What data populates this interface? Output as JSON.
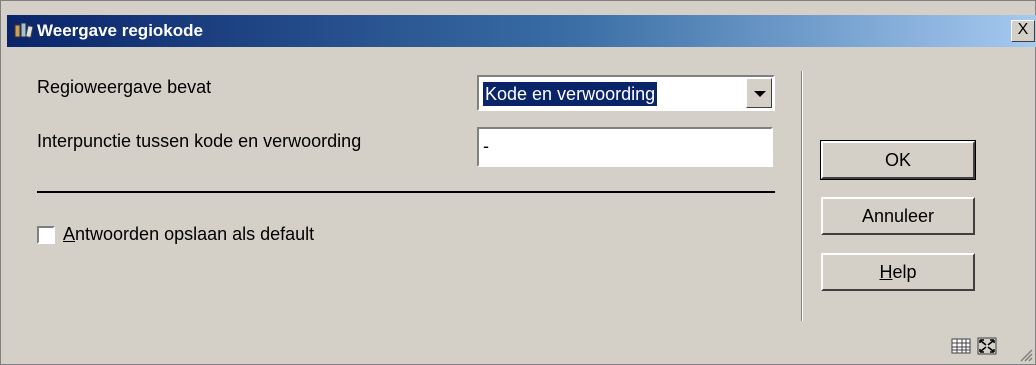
{
  "window": {
    "title": "Weergave regiokode",
    "close_label": "X"
  },
  "form": {
    "regio_label": "Regioweergave bevat",
    "regio_selected": "Kode en verwoording",
    "interpunctie_label": "Interpunctie tussen kode en verwoording",
    "interpunctie_value": "-",
    "default_checkbox_label": "Antwoorden opslaan als default",
    "default_checked": false
  },
  "buttons": {
    "ok": "OK",
    "cancel": "Annuleer",
    "help": "Help"
  },
  "icons": {
    "title": "books-icon",
    "grid": "grid-icon",
    "maximize": "maximize-icon"
  }
}
